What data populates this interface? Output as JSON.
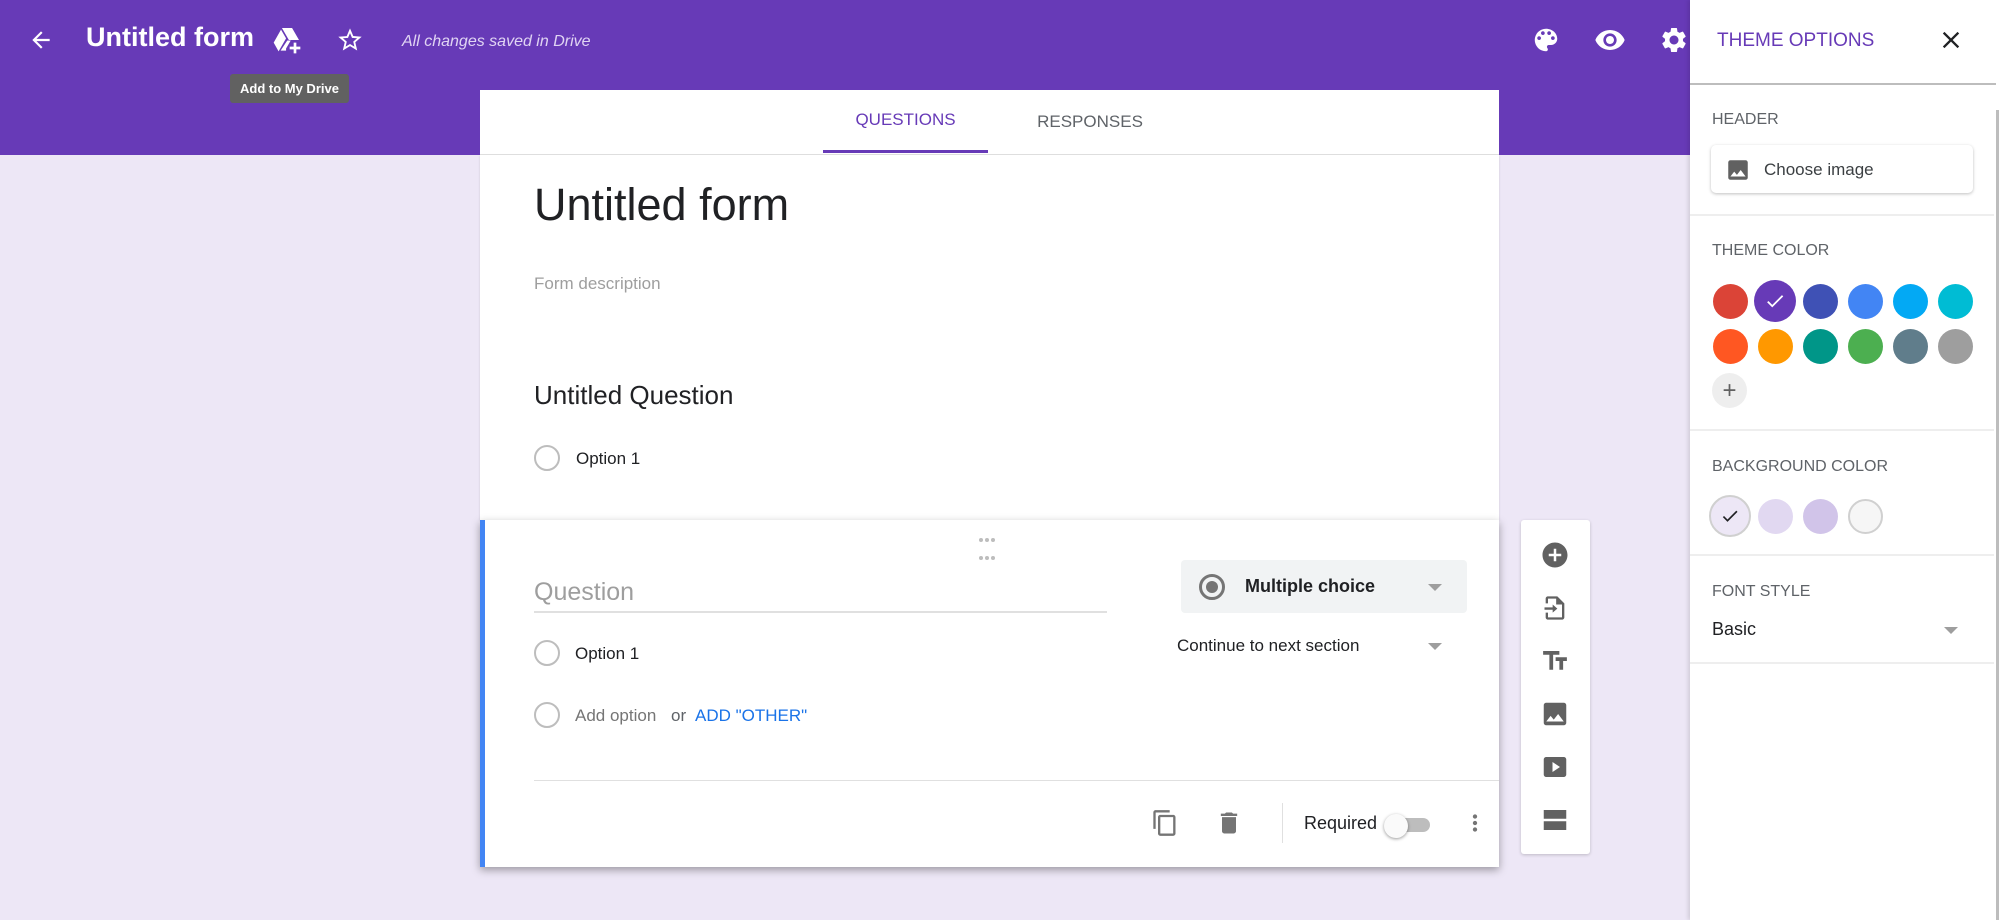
{
  "header": {
    "title": "Untitled form",
    "save_status": "All changes saved in Drive",
    "tooltip": "Add to My Drive",
    "icons": [
      "back-arrow-icon",
      "add-to-drive-icon",
      "star-icon",
      "palette-icon",
      "eye-icon",
      "gear-icon"
    ],
    "bar_color": "#673ab7"
  },
  "tabs": [
    {
      "label": "QUESTIONS",
      "active": true
    },
    {
      "label": "RESPONSES",
      "active": false
    }
  ],
  "form": {
    "title": "Untitled form",
    "description_placeholder": "Form description",
    "questions": [
      {
        "title": "Untitled Question",
        "options": [
          "Option 1"
        ]
      }
    ],
    "active_question": {
      "title_placeholder": "Question",
      "type": "Multiple choice",
      "navigation": "Continue to next section",
      "options": [
        "Option 1"
      ],
      "add_option": "Add option",
      "or_text": "or",
      "add_other": "ADD \"OTHER\"",
      "required_label": "Required",
      "required": false,
      "accent_color": "#4285f4"
    }
  },
  "side_toolbar": {
    "items": [
      {
        "name": "add-question",
        "icon": "add-circle-icon"
      },
      {
        "name": "import-questions",
        "icon": "import-icon"
      },
      {
        "name": "add-title",
        "icon": "title-text-icon"
      },
      {
        "name": "add-image",
        "icon": "image-icon"
      },
      {
        "name": "add-video",
        "icon": "video-icon"
      },
      {
        "name": "add-section",
        "icon": "section-icon"
      }
    ]
  },
  "theme_panel": {
    "title": "THEME OPTIONS",
    "header_label": "HEADER",
    "choose_image": "Choose image",
    "theme_color_label": "THEME COLOR",
    "theme_colors": [
      "#db4437",
      "#673ab7",
      "#3f51b5",
      "#4285f4",
      "#03a9f4",
      "#00bcd4",
      "#ff5722",
      "#ff9800",
      "#009688",
      "#4caf50",
      "#607d8b",
      "#9e9e9e"
    ],
    "selected_theme_color": "#673ab7",
    "background_color_label": "BACKGROUND COLOR",
    "background_colors": [
      "#ede7f6",
      "#e1d8f1",
      "#d1c4e9",
      "#f6f6f6"
    ],
    "selected_background_color": "#ede7f6",
    "font_style_label": "FONT STYLE",
    "font_style": "Basic"
  }
}
